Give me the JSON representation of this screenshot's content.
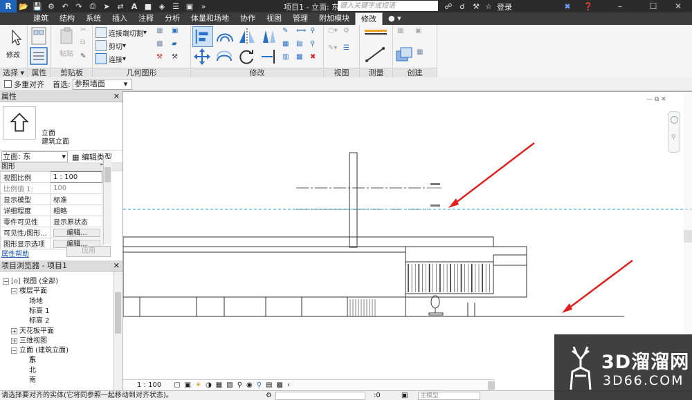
{
  "titlebar": {
    "title": "项目1 - 立面: 东",
    "search_placeholder": "键入关键字或短语",
    "login": "登录"
  },
  "tabs": [
    "建筑",
    "结构",
    "系统",
    "插入",
    "注释",
    "分析",
    "体量和场地",
    "协作",
    "视图",
    "管理",
    "附加模块",
    "修改"
  ],
  "active_tab": "修改",
  "ribbon": {
    "modify_label": "修改",
    "paste_label": "粘贴",
    "join_cut_label": "连接端切割",
    "cut_label": "剪切",
    "join_label": "连接",
    "panels": {
      "select": "选择",
      "properties": "属性",
      "clipboard": "剪贴板",
      "geometry": "几何图形",
      "modify": "修改",
      "view": "视图",
      "measure": "测量",
      "create": "创建"
    }
  },
  "optionsbar": {
    "multi_align": "多重对齐",
    "prefer_label": "首选:",
    "prefer_value": "参照墙面"
  },
  "properties": {
    "header": "属性",
    "type_name_1": "立面",
    "type_name_2": "建筑立面",
    "instance": "立面: 东",
    "edit_type": "编辑类型",
    "group": "图形",
    "rows": [
      {
        "label": "视图比例",
        "value": "1 : 100"
      },
      {
        "label": "比例值 1:",
        "value": "100"
      },
      {
        "label": "显示模型",
        "value": "标准"
      },
      {
        "label": "详细程度",
        "value": "粗略"
      },
      {
        "label": "零件可见性",
        "value": "显示原状态"
      },
      {
        "label": "可见性/图形...",
        "value": "编辑..."
      },
      {
        "label": "图形显示选项",
        "value": "编辑..."
      }
    ],
    "help": "属性帮助",
    "apply": "应用"
  },
  "browser": {
    "header": "项目浏览器 - 项目1",
    "items": [
      {
        "label": "视图 (全部)"
      },
      {
        "label": "楼层平面"
      },
      {
        "label": "场地"
      },
      {
        "label": "标高 1"
      },
      {
        "label": "标高 2"
      },
      {
        "label": "天花板平面"
      },
      {
        "label": "三维视图"
      },
      {
        "label": "立面 (建筑立面)"
      },
      {
        "label": "东"
      },
      {
        "label": "北"
      },
      {
        "label": "南"
      }
    ]
  },
  "viewbar": {
    "scale": "1 : 100"
  },
  "status": {
    "text": "请选择要对齐的实体(它将同参照一起移动到对齐状态)。",
    "zero": ":0",
    "model": "主模型"
  },
  "watermark": {
    "line1": "3D溜溜网",
    "line2": "3D66.COM"
  },
  "colors": {
    "arrow": "#e0201e",
    "ref_line": "#2aa7d6",
    "titlebar": "#2b2b2b"
  }
}
